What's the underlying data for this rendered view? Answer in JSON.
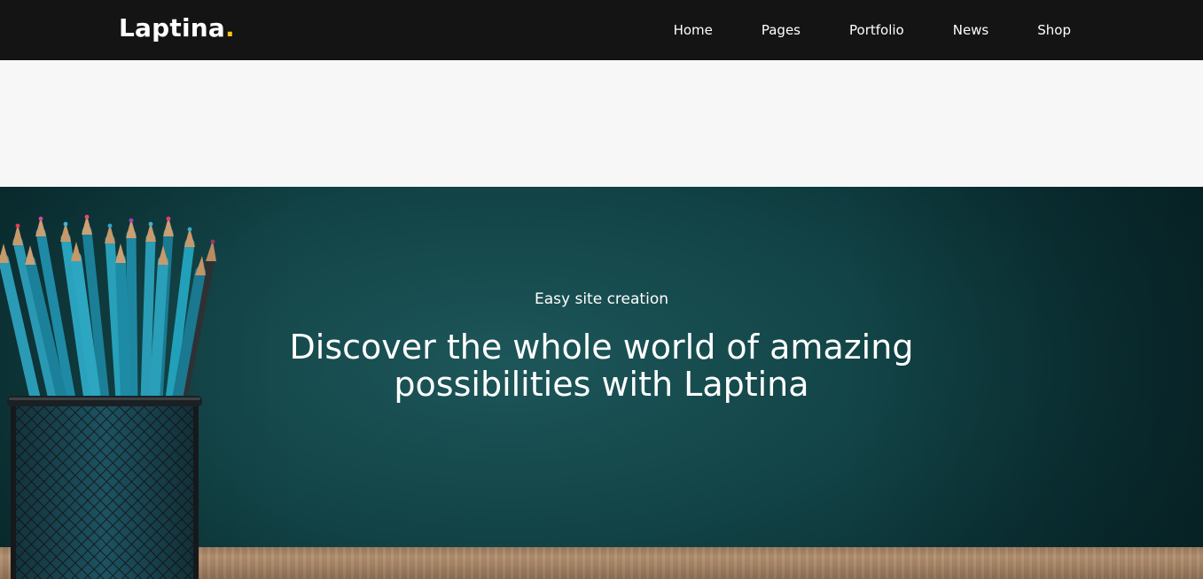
{
  "header": {
    "logo_text": "Laptina",
    "logo_dot": ".",
    "nav": [
      {
        "label": "Home"
      },
      {
        "label": "Pages"
      },
      {
        "label": "Portfolio"
      },
      {
        "label": "News"
      },
      {
        "label": "Shop"
      }
    ]
  },
  "hero": {
    "kicker": "Easy site creation",
    "title_line1": "Discover the whole world of amazing",
    "title_line2": "possibilities with Laptina"
  },
  "colors": {
    "header_bg": "#141414",
    "logo_accent": "#f5c518",
    "hero_bg": "#124447",
    "text": "#ffffff"
  },
  "icons": {
    "hero_image": "pencil-cup-image"
  }
}
